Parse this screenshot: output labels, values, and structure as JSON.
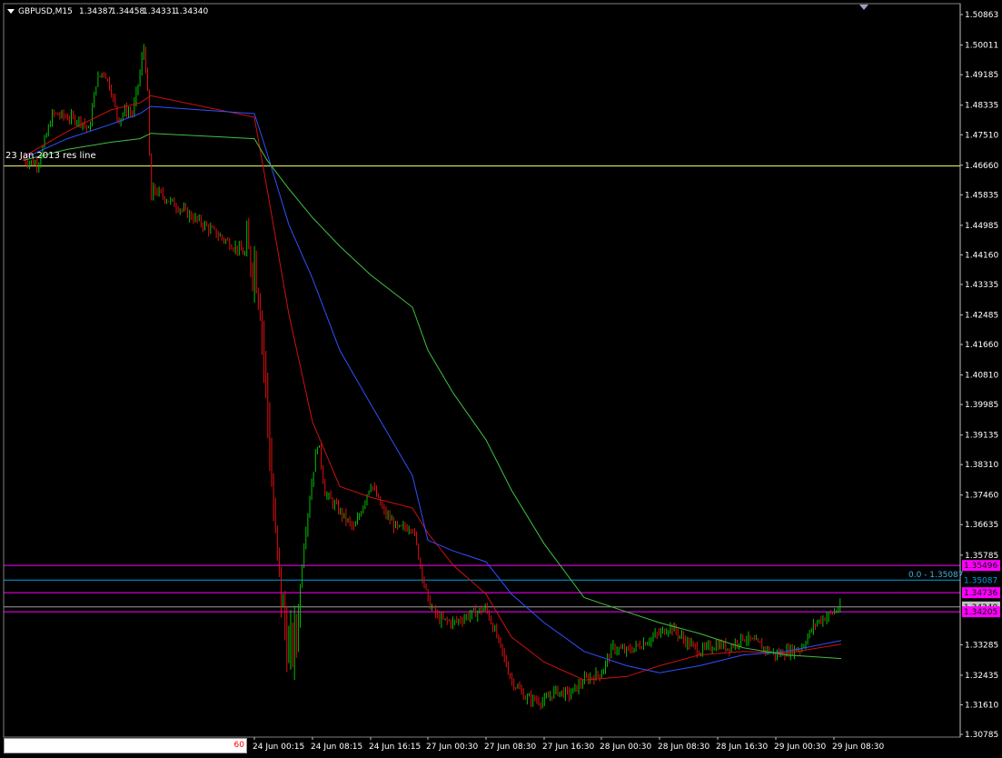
{
  "header": {
    "symbol": "GBPUSD,M15",
    "open": "1.34387",
    "high": "1.34458",
    "low": "1.34331",
    "close": "1.34340"
  },
  "bottom_input": {
    "value": "60"
  },
  "annotations": {
    "res_line_label": "23 Jan 2013 res line",
    "fib_label": "0.0 - 1.35087"
  },
  "colors": {
    "background": "#000000",
    "axis": "#ffffff",
    "candle_up": "#00c000",
    "candle_down": "#e01010",
    "ma_fast": "#d01010",
    "ma_mid": "#3050ff",
    "ma_slow": "#40c040",
    "res_line": "#ffff66",
    "magenta_line": "#ff00ff",
    "fib_line": "#00a0e0",
    "gray_line": "#a0a0a0"
  },
  "chart_data": {
    "type": "line",
    "title": "GBPUSD,M15",
    "y_range": [
      1.30785,
      1.50863
    ],
    "y_ticks": [
      "1.50863",
      "1.50011",
      "1.49185",
      "1.48335",
      "1.47510",
      "1.46660",
      "1.45835",
      "1.44985",
      "1.44160",
      "1.43335",
      "1.42485",
      "1.41660",
      "1.40810",
      "1.39985",
      "1.39135",
      "1.38310",
      "1.37460",
      "1.36635",
      "1.35785"
    ],
    "y_ticks_lower": [
      "1.33285",
      "1.32435",
      "1.31610",
      "1.30785"
    ],
    "x_ticks": [
      "24 Jun 00:15",
      "24 Jun 08:15",
      "24 Jun 16:15",
      "27 Jun 00:30",
      "27 Jun 08:30",
      "27 Jun 16:30",
      "28 Jun 00:30",
      "28 Jun 08:30",
      "28 Jun 16:30",
      "29 Jun 00:30",
      "29 Jun 08:30"
    ],
    "horizontal_levels": [
      {
        "label": "1.35496",
        "value": 1.35496,
        "style": "magenta"
      },
      {
        "label": "1.35087",
        "value": 1.35087,
        "style": "fib"
      },
      {
        "label": "1.34736",
        "value": 1.34736,
        "style": "magenta"
      },
      {
        "label": "1.34340",
        "value": 1.3434,
        "style": "gray"
      },
      {
        "label": "1.34205",
        "value": 1.34205,
        "style": "magenta"
      },
      {
        "label": "",
        "value": 1.4664,
        "style": "res"
      }
    ],
    "price_path": [
      {
        "x": "23 Jun 06:00",
        "y": 1.468
      },
      {
        "x": "23 Jun 08:00",
        "y": 1.467
      },
      {
        "x": "23 Jun 10:00",
        "y": 1.481
      },
      {
        "x": "23 Jun 12:00",
        "y": 1.48
      },
      {
        "x": "23 Jun 14:00",
        "y": 1.479
      },
      {
        "x": "23 Jun 15:00",
        "y": 1.476
      },
      {
        "x": "23 Jun 16:00",
        "y": 1.49
      },
      {
        "x": "23 Jun 17:00",
        "y": 1.493
      },
      {
        "x": "23 Jun 18:00",
        "y": 1.488
      },
      {
        "x": "23 Jun 19:00",
        "y": 1.479
      },
      {
        "x": "23 Jun 20:00",
        "y": 1.482
      },
      {
        "x": "23 Jun 21:00",
        "y": 1.481
      },
      {
        "x": "23 Jun 22:00",
        "y": 1.492
      },
      {
        "x": "23 Jun 22:30",
        "y": 1.5
      },
      {
        "x": "23 Jun 23:00",
        "y": 1.49
      },
      {
        "x": "23 Jun 23:15",
        "y": 1.475
      },
      {
        "x": "23 Jun 23:30",
        "y": 1.455
      },
      {
        "x": "23 Jun 23:45",
        "y": 1.46
      },
      {
        "x": "24 Jun 00:15",
        "y": 1.44
      },
      {
        "x": "24 Jun 01:00",
        "y": 1.43
      },
      {
        "x": "24 Jun 02:00",
        "y": 1.4
      },
      {
        "x": "24 Jun 03:00",
        "y": 1.365
      },
      {
        "x": "24 Jun 04:00",
        "y": 1.345
      },
      {
        "x": "24 Jun 05:00",
        "y": 1.33
      },
      {
        "x": "24 Jun 06:00",
        "y": 1.335
      },
      {
        "x": "24 Jun 07:00",
        "y": 1.36
      },
      {
        "x": "24 Jun 08:15",
        "y": 1.38
      },
      {
        "x": "24 Jun 09:00",
        "y": 1.39
      },
      {
        "x": "24 Jun 10:00",
        "y": 1.375
      },
      {
        "x": "24 Jun 12:00",
        "y": 1.37
      },
      {
        "x": "24 Jun 14:00",
        "y": 1.365
      },
      {
        "x": "24 Jun 16:15",
        "y": 1.378
      },
      {
        "x": "24 Jun 18:00",
        "y": 1.37
      },
      {
        "x": "24 Jun 20:00",
        "y": 1.365
      },
      {
        "x": "24 Jun 22:00",
        "y": 1.366
      },
      {
        "x": "27 Jun 00:30",
        "y": 1.345
      },
      {
        "x": "27 Jun 02:00",
        "y": 1.34
      },
      {
        "x": "27 Jun 04:00",
        "y": 1.339
      },
      {
        "x": "27 Jun 06:00",
        "y": 1.341
      },
      {
        "x": "27 Jun 08:30",
        "y": 1.343
      },
      {
        "x": "27 Jun 10:00",
        "y": 1.335
      },
      {
        "x": "27 Jun 12:00",
        "y": 1.323
      },
      {
        "x": "27 Jun 14:00",
        "y": 1.318
      },
      {
        "x": "27 Jun 16:30",
        "y": 1.317
      },
      {
        "x": "27 Jun 18:00",
        "y": 1.32
      },
      {
        "x": "27 Jun 20:00",
        "y": 1.319
      },
      {
        "x": "27 Jun 22:00",
        "y": 1.323
      },
      {
        "x": "28 Jun 00:30",
        "y": 1.325
      },
      {
        "x": "28 Jun 02:00",
        "y": 1.332
      },
      {
        "x": "28 Jun 04:00",
        "y": 1.331
      },
      {
        "x": "28 Jun 06:00",
        "y": 1.333
      },
      {
        "x": "28 Jun 08:30",
        "y": 1.336
      },
      {
        "x": "28 Jun 10:00",
        "y": 1.338
      },
      {
        "x": "28 Jun 12:00",
        "y": 1.334
      },
      {
        "x": "28 Jun 14:00",
        "y": 1.331
      },
      {
        "x": "28 Jun 16:30",
        "y": 1.333
      },
      {
        "x": "28 Jun 18:00",
        "y": 1.332
      },
      {
        "x": "28 Jun 20:00",
        "y": 1.335
      },
      {
        "x": "28 Jun 22:00",
        "y": 1.333
      },
      {
        "x": "29 Jun 00:30",
        "y": 1.33
      },
      {
        "x": "29 Jun 02:00",
        "y": 1.331
      },
      {
        "x": "29 Jun 04:00",
        "y": 1.332
      },
      {
        "x": "29 Jun 06:00",
        "y": 1.339
      },
      {
        "x": "29 Jun 08:30",
        "y": 1.342
      },
      {
        "x": "29 Jun 09:30",
        "y": 1.3434
      }
    ],
    "series": [
      {
        "style": "ma_fast",
        "values": [
          {
            "x": "23 Jun 06:00",
            "y": 1.469
          },
          {
            "x": "23 Jun 12:00",
            "y": 1.476
          },
          {
            "x": "23 Jun 18:00",
            "y": 1.482
          },
          {
            "x": "23 Jun 22:00",
            "y": 1.484
          },
          {
            "x": "23 Jun 23:30",
            "y": 1.486
          },
          {
            "x": "24 Jun 00:15",
            "y": 1.48
          },
          {
            "x": "24 Jun 02:00",
            "y": 1.46
          },
          {
            "x": "24 Jun 05:00",
            "y": 1.425
          },
          {
            "x": "24 Jun 08:15",
            "y": 1.395
          },
          {
            "x": "24 Jun 12:00",
            "y": 1.377
          },
          {
            "x": "24 Jun 16:15",
            "y": 1.374
          },
          {
            "x": "24 Jun 22:00",
            "y": 1.371
          },
          {
            "x": "27 Jun 00:30",
            "y": 1.364
          },
          {
            "x": "27 Jun 04:00",
            "y": 1.355
          },
          {
            "x": "27 Jun 08:30",
            "y": 1.347
          },
          {
            "x": "27 Jun 12:00",
            "y": 1.335
          },
          {
            "x": "27 Jun 16:30",
            "y": 1.328
          },
          {
            "x": "27 Jun 22:00",
            "y": 1.323
          },
          {
            "x": "28 Jun 04:00",
            "y": 1.324
          },
          {
            "x": "28 Jun 08:30",
            "y": 1.327
          },
          {
            "x": "28 Jun 14:00",
            "y": 1.33
          },
          {
            "x": "28 Jun 20:00",
            "y": 1.331
          },
          {
            "x": "29 Jun 02:00",
            "y": 1.3305
          },
          {
            "x": "29 Jun 09:30",
            "y": 1.333
          }
        ]
      },
      {
        "style": "ma_mid",
        "values": [
          {
            "x": "23 Jun 06:00",
            "y": 1.4685
          },
          {
            "x": "23 Jun 12:00",
            "y": 1.474
          },
          {
            "x": "23 Jun 18:00",
            "y": 1.478
          },
          {
            "x": "23 Jun 22:00",
            "y": 1.481
          },
          {
            "x": "23 Jun 23:30",
            "y": 1.483
          },
          {
            "x": "24 Jun 00:15",
            "y": 1.481
          },
          {
            "x": "24 Jun 02:00",
            "y": 1.47
          },
          {
            "x": "24 Jun 05:00",
            "y": 1.45
          },
          {
            "x": "24 Jun 08:15",
            "y": 1.435
          },
          {
            "x": "24 Jun 12:00",
            "y": 1.415
          },
          {
            "x": "24 Jun 16:15",
            "y": 1.4
          },
          {
            "x": "24 Jun 22:00",
            "y": 1.38
          },
          {
            "x": "27 Jun 00:30",
            "y": 1.362
          },
          {
            "x": "27 Jun 04:00",
            "y": 1.359
          },
          {
            "x": "27 Jun 08:30",
            "y": 1.356
          },
          {
            "x": "27 Jun 12:00",
            "y": 1.347
          },
          {
            "x": "27 Jun 16:30",
            "y": 1.339
          },
          {
            "x": "27 Jun 22:00",
            "y": 1.331
          },
          {
            "x": "28 Jun 04:00",
            "y": 1.327
          },
          {
            "x": "28 Jun 08:30",
            "y": 1.325
          },
          {
            "x": "28 Jun 14:00",
            "y": 1.327
          },
          {
            "x": "28 Jun 20:00",
            "y": 1.33
          },
          {
            "x": "29 Jun 02:00",
            "y": 1.331
          },
          {
            "x": "29 Jun 09:30",
            "y": 1.334
          }
        ]
      },
      {
        "style": "ma_slow",
        "values": [
          {
            "x": "23 Jun 06:00",
            "y": 1.468
          },
          {
            "x": "23 Jun 12:00",
            "y": 1.471
          },
          {
            "x": "23 Jun 18:00",
            "y": 1.473
          },
          {
            "x": "23 Jun 22:00",
            "y": 1.474
          },
          {
            "x": "23 Jun 23:30",
            "y": 1.4755
          },
          {
            "x": "24 Jun 00:15",
            "y": 1.474
          },
          {
            "x": "24 Jun 02:00",
            "y": 1.468
          },
          {
            "x": "24 Jun 05:00",
            "y": 1.46
          },
          {
            "x": "24 Jun 08:15",
            "y": 1.452
          },
          {
            "x": "24 Jun 12:00",
            "y": 1.444
          },
          {
            "x": "24 Jun 16:15",
            "y": 1.436
          },
          {
            "x": "24 Jun 22:00",
            "y": 1.427
          },
          {
            "x": "27 Jun 00:30",
            "y": 1.415
          },
          {
            "x": "27 Jun 04:00",
            "y": 1.403
          },
          {
            "x": "27 Jun 08:30",
            "y": 1.39
          },
          {
            "x": "27 Jun 12:00",
            "y": 1.376
          },
          {
            "x": "27 Jun 16:30",
            "y": 1.361
          },
          {
            "x": "27 Jun 22:00",
            "y": 1.346
          },
          {
            "x": "28 Jun 04:00",
            "y": 1.342
          },
          {
            "x": "28 Jun 08:30",
            "y": 1.339
          },
          {
            "x": "28 Jun 14:00",
            "y": 1.336
          },
          {
            "x": "28 Jun 20:00",
            "y": 1.332
          },
          {
            "x": "29 Jun 02:00",
            "y": 1.33
          },
          {
            "x": "29 Jun 09:30",
            "y": 1.329
          }
        ]
      }
    ]
  }
}
